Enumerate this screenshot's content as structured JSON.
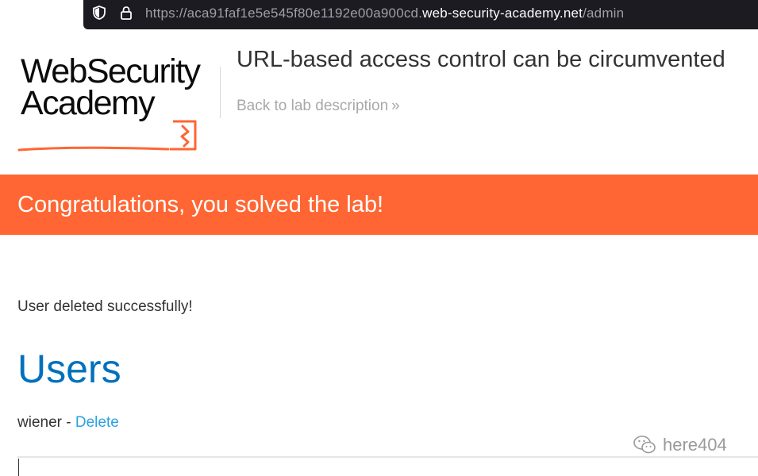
{
  "browser": {
    "url_prefix": "https://aca91faf1e5e545f80e1192e00a900cd.",
    "url_domain": "web-security-academy.net",
    "url_path": "/admin",
    "icons": [
      "shield-icon",
      "lock-icon"
    ]
  },
  "header": {
    "logo_line1": "WebSecurity",
    "logo_line2": "Academy",
    "lab_title": "URL-based access control can be circumvented",
    "back_link": "Back to lab description",
    "back_chevrons": "»"
  },
  "banner": {
    "text": "Congratulations, you solved the lab!",
    "color": "#ff6633"
  },
  "main": {
    "message": "User deleted successfully!",
    "heading": "Users",
    "users": [
      {
        "name": "wiener",
        "separator": " - ",
        "action": "Delete"
      }
    ]
  },
  "watermark": {
    "text": "here404",
    "icon": "wechat-icon"
  },
  "colors": {
    "accent": "#ff6633",
    "heading": "#0071bc",
    "link": "#29a2e1"
  }
}
